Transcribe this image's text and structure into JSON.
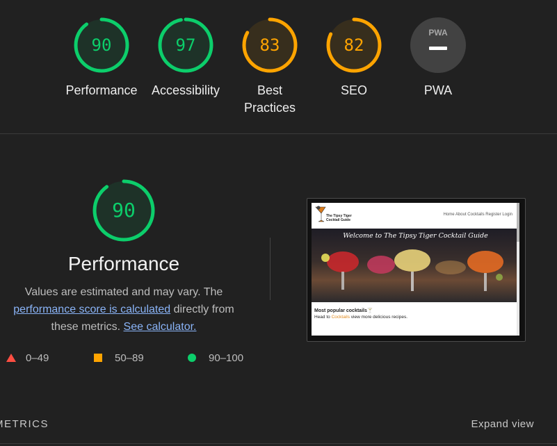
{
  "gauges": [
    {
      "score": "90",
      "label": "Performance",
      "color": "#0cce6b",
      "fraction": 0.9
    },
    {
      "score": "97",
      "label": "Accessibility",
      "color": "#0cce6b",
      "fraction": 0.97
    },
    {
      "score": "83",
      "label_line1": "Best",
      "label_line2": "Practices",
      "color": "#ffa400",
      "fraction": 0.83
    },
    {
      "score": "82",
      "label": "SEO",
      "color": "#ffa400",
      "fraction": 0.82
    },
    {
      "badge": "PWA",
      "label": "PWA"
    }
  ],
  "performance": {
    "score": "90",
    "fraction": 0.9,
    "title": "Performance",
    "desc_prefix": "Values are estimated and may vary. The ",
    "desc_link1": "performance score is calculated",
    "desc_middle": " directly from these metrics. ",
    "desc_link2": "See calculator."
  },
  "legend": {
    "fail": "0–49",
    "average": "50–89",
    "pass": "90–100"
  },
  "screenshot": {
    "logo_line1": "The Tipsy Tiger",
    "logo_line2": "Cocktail Guide",
    "nav_links": "Home   About   Cocktails   Register   Login",
    "headline": "Welcome to The Tipsy Tiger Cocktail Guide",
    "section_title": "Most popular cocktails🍸",
    "text_before": "Head to ",
    "text_link": "Cocktails",
    "text_after": " view more delicious recipes."
  },
  "footer": {
    "metrics_label": "METRICS",
    "expand_label": "Expand view"
  },
  "colors": {
    "pass": "#0cce6b",
    "average": "#ffa400",
    "fail": "#ff4e42",
    "background": "#212121",
    "link": "#8ab4f8"
  }
}
